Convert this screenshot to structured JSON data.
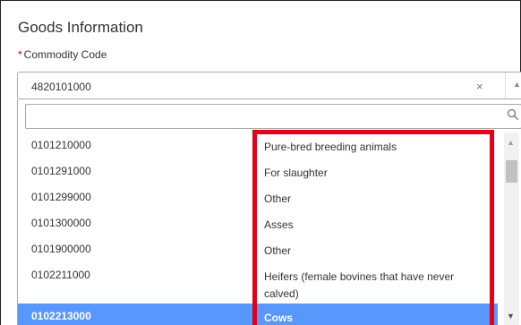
{
  "section_title": "Goods Information",
  "field": {
    "required_marker": "*",
    "label": "Commodity Code",
    "value": "4820101000",
    "clear_glyph": "×",
    "arrow_glyph": "▲"
  },
  "search": {
    "value": "",
    "placeholder": ""
  },
  "options": [
    {
      "code": "0101210000",
      "description": "Pure-bred breeding animals"
    },
    {
      "code": "0101291000",
      "description": "For slaughter"
    },
    {
      "code": "0101299000",
      "description": "Other"
    },
    {
      "code": "0101300000",
      "description": "Asses"
    },
    {
      "code": "0101900000",
      "description": "Other"
    },
    {
      "code": "0102211000",
      "description": "Heifers (female bovines that have never calved)"
    },
    {
      "code": "0102213000",
      "description": "Cows"
    }
  ],
  "selected_option_index": 6,
  "scrollbar": {
    "up_glyph": "▲",
    "down_glyph": "▼"
  },
  "colors": {
    "highlight": "#e3001b",
    "selected_bg": "#5897fb"
  },
  "icons": {
    "clear": "close-icon",
    "select_arrow": "chevron-up-icon",
    "search": "search-icon",
    "scroll_up": "triangle-up-icon",
    "scroll_down": "triangle-down-icon"
  }
}
